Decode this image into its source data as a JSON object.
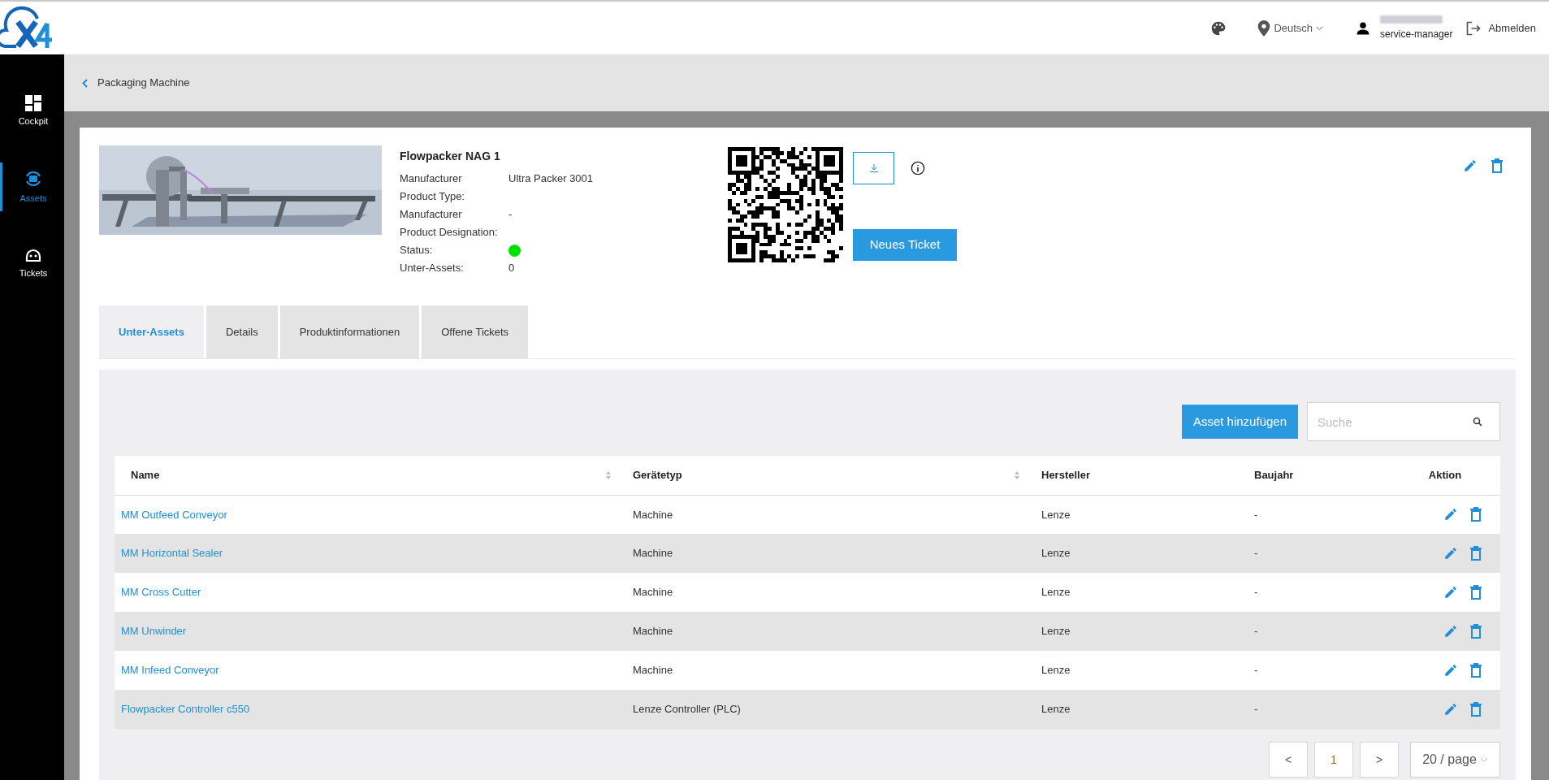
{
  "header": {
    "language": "Deutsch",
    "user_role": "service-manager",
    "logout": "Abmelden"
  },
  "sidebar": {
    "items": [
      {
        "label": "Cockpit",
        "kind": "grid",
        "selected": false
      },
      {
        "label": "Assets",
        "kind": "assets",
        "selected": true
      },
      {
        "label": "Tickets",
        "kind": "ticket",
        "selected": false
      }
    ]
  },
  "breadcrumb": "Packaging Machine",
  "asset": {
    "title": "Flowpacker NAG 1",
    "fields": [
      {
        "label": "Manufacturer",
        "value": "Ultra Packer 3001",
        "kind": "text"
      },
      {
        "label": "Product Type:",
        "kind": "text"
      },
      {
        "label": "Manufacturer",
        "value": "-",
        "kind": "text"
      },
      {
        "label": "Product Designation:",
        "kind": "text"
      },
      {
        "label": "Status:",
        "kind": "status",
        "color": "#00e000"
      },
      {
        "label": "Unter-Assets:",
        "value": "0",
        "kind": "text"
      }
    ],
    "new_ticket_button": "Neues Ticket"
  },
  "tabs": [
    {
      "label": "Unter-Assets",
      "selected": true
    },
    {
      "label": "Details",
      "selected": false
    },
    {
      "label": "Produktinformationen",
      "selected": false
    },
    {
      "label": "Offene Tickets",
      "selected": false
    }
  ],
  "toolbar": {
    "add_button": "Asset hinzufügen",
    "search_placeholder": "Suche"
  },
  "table": {
    "columns": [
      {
        "label": "Name",
        "sortable": true
      },
      {
        "label": "Gerätetyp",
        "sortable": true
      },
      {
        "label": "Hersteller",
        "sortable": false
      },
      {
        "label": "Baujahr",
        "sortable": false
      },
      {
        "label": "Aktion",
        "sortable": false
      }
    ],
    "rows": [
      {
        "name": "MM Outfeed Conveyor",
        "type": "Machine",
        "maker": "Lenze",
        "year": "-"
      },
      {
        "name": "MM Horizontal Sealer",
        "type": "Machine",
        "maker": "Lenze",
        "year": "-"
      },
      {
        "name": "MM Cross Cutter",
        "type": "Machine",
        "maker": "Lenze",
        "year": "-"
      },
      {
        "name": "MM Unwinder",
        "type": "Machine",
        "maker": "Lenze",
        "year": "-"
      },
      {
        "name": "MM Infeed Conveyor",
        "type": "Machine",
        "maker": "Lenze",
        "year": "-"
      },
      {
        "name": "Flowpacker Controller c550",
        "type": "Lenze Controller (PLC)",
        "maker": "Lenze",
        "year": "-"
      }
    ]
  },
  "pagination": {
    "prev": "<",
    "current_page": "1",
    "next": ">",
    "page_size": "20 / page"
  }
}
